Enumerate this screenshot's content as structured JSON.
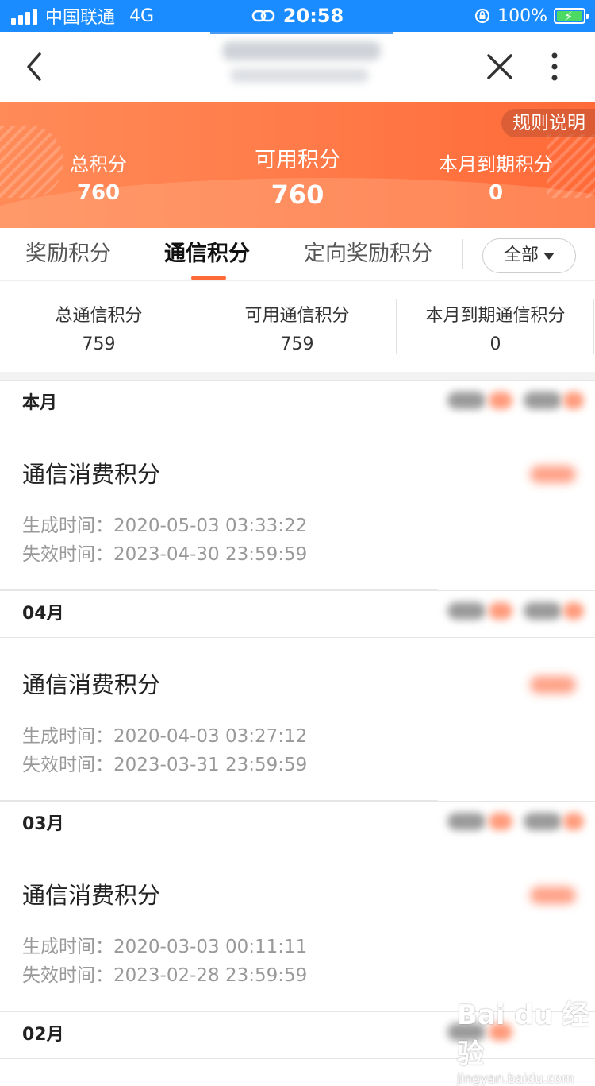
{
  "status_bar": {
    "carrier": "中国联通",
    "network": "4G",
    "time": "20:58",
    "battery": "100%"
  },
  "header": {
    "rules_label": "规则说明",
    "total": {
      "label": "总积分",
      "value": "760"
    },
    "available": {
      "label": "可用积分",
      "value": "760"
    },
    "expiring": {
      "label": "本月到期积分",
      "value": "0"
    }
  },
  "tabs": {
    "items": [
      {
        "label": "奖励积分"
      },
      {
        "label": "通信积分"
      },
      {
        "label": "定向奖励积分"
      }
    ],
    "active_index": 1,
    "filter_label": "全部"
  },
  "substats": {
    "total": {
      "label": "总通信积分",
      "value": "759"
    },
    "available": {
      "label": "可用通信积分",
      "value": "759"
    },
    "expiring": {
      "label": "本月到期通信积分",
      "value": "0"
    }
  },
  "records": [
    {
      "month": "本月",
      "title": "通信消费积分",
      "generated": "生成时间：2020-05-03 03:33:22",
      "expires": "失效时间：2023-04-30 23:59:59"
    },
    {
      "month": "04月",
      "title": "通信消费积分",
      "generated": "生成时间：2020-04-03 03:27:12",
      "expires": "失效时间：2023-03-31 23:59:59"
    },
    {
      "month": "03月",
      "title": "通信消费积分",
      "generated": "生成时间：2020-03-03 00:11:11",
      "expires": "失效时间：2023-02-28 23:59:59"
    }
  ],
  "last_month": "02月",
  "watermark": {
    "brand": "Bai du 经验",
    "site": "jingyan.baidu.com"
  },
  "colors": {
    "accent": "#ff6a38",
    "status_bar": "#1a8cff"
  }
}
